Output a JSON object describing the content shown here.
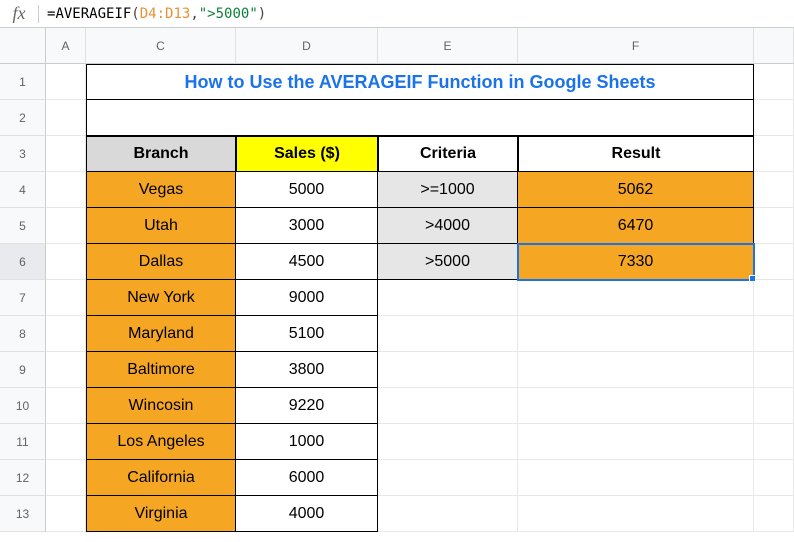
{
  "formula_bar": {
    "fx_label": "fx",
    "prefix": "=",
    "function_name": "AVERAGEIF",
    "open_paren": "(",
    "arg_range": "D4:D13",
    "comma": ",",
    "arg_criteria": "\">5000\"",
    "close_paren": ")"
  },
  "columns": {
    "a": "A",
    "c": "C",
    "d": "D",
    "e": "E",
    "f": "F"
  },
  "rows": {
    "r1": "1",
    "r2": "2",
    "r3": "3",
    "r4": "4",
    "r5": "5",
    "r6": "6",
    "r7": "7",
    "r8": "8",
    "r9": "9",
    "r10": "10",
    "r11": "11",
    "r12": "12",
    "r13": "13"
  },
  "title": "How to Use the AVERAGEIF Function in Google Sheets",
  "headers": {
    "branch": "Branch",
    "sales": "Sales ($)",
    "criteria": "Criteria",
    "result": "Result"
  },
  "data": {
    "branches": [
      "Vegas",
      "Utah",
      "Dallas",
      "New York",
      "Maryland",
      "Baltimore",
      "Wincosin",
      "Los Angeles",
      "California",
      "Virginia"
    ],
    "sales": [
      "5000",
      "3000",
      "4500",
      "9000",
      "5100",
      "3800",
      "9220",
      "1000",
      "6000",
      "4000"
    ]
  },
  "criteria": [
    ">=1000",
    ">4000",
    ">5000"
  ],
  "results": [
    "5062",
    "6470",
    "7330"
  ],
  "selection": {
    "active_cell": "F6"
  },
  "chart_data": {
    "type": "table",
    "title": "How to Use the AVERAGEIF Function in Google Sheets",
    "columns": [
      "Branch",
      "Sales ($)",
      "Criteria",
      "Result"
    ],
    "rows": [
      {
        "Branch": "Vegas",
        "Sales ($)": 5000,
        "Criteria": ">=1000",
        "Result": 5062
      },
      {
        "Branch": "Utah",
        "Sales ($)": 3000,
        "Criteria": ">4000",
        "Result": 6470
      },
      {
        "Branch": "Dallas",
        "Sales ($)": 4500,
        "Criteria": ">5000",
        "Result": 7330
      },
      {
        "Branch": "New York",
        "Sales ($)": 9000
      },
      {
        "Branch": "Maryland",
        "Sales ($)": 5100
      },
      {
        "Branch": "Baltimore",
        "Sales ($)": 3800
      },
      {
        "Branch": "Wincosin",
        "Sales ($)": 9220
      },
      {
        "Branch": "Los Angeles",
        "Sales ($)": 1000
      },
      {
        "Branch": "California",
        "Sales ($)": 6000
      },
      {
        "Branch": "Virginia",
        "Sales ($)": 4000
      }
    ]
  }
}
